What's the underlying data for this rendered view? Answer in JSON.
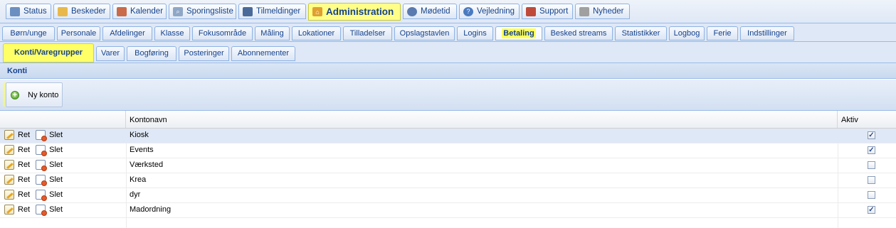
{
  "main_tabs": [
    {
      "label": "Status",
      "icon": "status-icon"
    },
    {
      "label": "Beskeder",
      "icon": "mail-icon"
    },
    {
      "label": "Kalender",
      "icon": "calendar-icon"
    },
    {
      "label": "Sporingsliste",
      "icon": "magnifier-icon"
    },
    {
      "label": "Tilmeldinger",
      "icon": "car-icon"
    },
    {
      "label": "Administration",
      "icon": "home-icon"
    },
    {
      "label": "Mødetid",
      "icon": "clock-icon"
    },
    {
      "label": "Vejledning",
      "icon": "help-icon"
    },
    {
      "label": "Support",
      "icon": "document-icon"
    },
    {
      "label": "Nyheder",
      "icon": "tag-icon"
    }
  ],
  "admin_tabs": [
    "Børn/unge",
    "Personale",
    "Afdelinger",
    "Klasse",
    "Fokusområde",
    "Måling",
    "Lokationer",
    "Tilladelser",
    "Opslagstavlen",
    "Logins",
    "Betaling",
    "Besked streams",
    "Statistikker",
    "Logbog",
    "Ferie",
    "Indstillinger"
  ],
  "betaling_tabs": [
    "Konti/Varegrupper",
    "Varer",
    "Bogføring",
    "Posteringer",
    "Abonnementer"
  ],
  "panel": {
    "title": "Konti",
    "new_button": "Ny konto"
  },
  "grid": {
    "columns": {
      "name": "Kontonavn",
      "active": "Aktiv"
    },
    "edit_label": "Ret",
    "delete_label": "Slet",
    "rows": [
      {
        "name": "Kiosk",
        "active": true
      },
      {
        "name": "Events",
        "active": true
      },
      {
        "name": "Værksted",
        "active": false
      },
      {
        "name": "Krea",
        "active": false
      },
      {
        "name": "dyr",
        "active": false
      },
      {
        "name": "Madordning",
        "active": true
      }
    ]
  },
  "colors": {
    "highlight": "#ffff5a",
    "tab_text": "#15428b",
    "border": "#99bbe8"
  }
}
